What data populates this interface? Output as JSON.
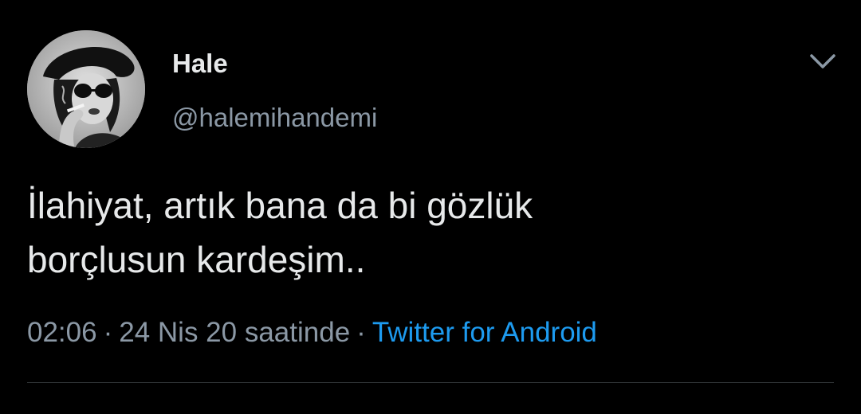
{
  "tweet": {
    "author": {
      "display_name": "Hale",
      "handle": "@halemihandemi",
      "avatar_icon": "profile-photo"
    },
    "text": "İlahiyat, artık bana da bi gözlük\nborçlusun kardeşim..",
    "time": "02:06",
    "date": "24 Nis 20 saatinde",
    "source": "Twitter for Android",
    "separator": "·",
    "menu_icon": "chevron-down-icon"
  },
  "colors": {
    "background": "#000000",
    "primary_text": "#e7e9ea",
    "secondary_text": "#8b98a5",
    "link": "#1d9bf0",
    "divider": "#2f3336"
  }
}
